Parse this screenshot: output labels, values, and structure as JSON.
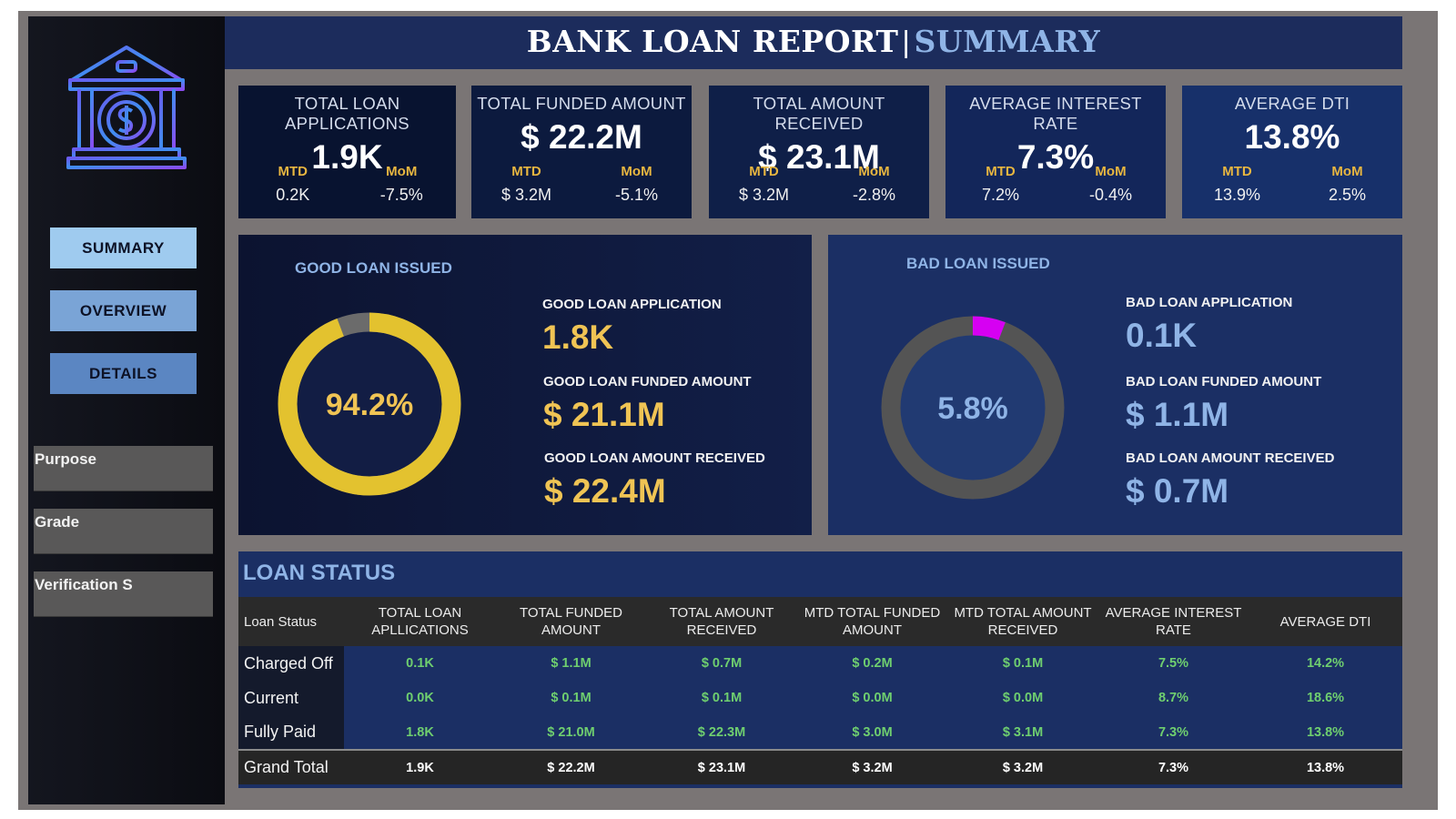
{
  "header": {
    "title_main": "BANK LOAN REPORT",
    "separator": "|",
    "title_section": "SUMMARY"
  },
  "nav": {
    "summary": "SUMMARY",
    "overview": "OVERVIEW",
    "details": "DETAILS"
  },
  "filters": {
    "purpose": "Purpose",
    "grade": "Grade",
    "verification": "Verification S"
  },
  "kpis": [
    {
      "title": "TOTAL LOAN APPLICATIONS",
      "value": "1.9K",
      "mtd_label": "MTD",
      "mtd": "0.2K",
      "mom_label": "MoM",
      "mom": "-7.5%"
    },
    {
      "title": "TOTAL FUNDED AMOUNT",
      "value": "$ 22.2M",
      "mtd_label": "MTD",
      "mtd": "$ 3.2M",
      "mom_label": "MoM",
      "mom": "-5.1%"
    },
    {
      "title": "TOTAL  AMOUNT RECEIVED",
      "value": "$ 23.1M",
      "mtd_label": "MTD",
      "mtd": "$ 3.2M",
      "mom_label": "MoM",
      "mom": "-2.8%"
    },
    {
      "title": "AVERAGE INTEREST RATE",
      "value": "7.3%",
      "mtd_label": "MTD",
      "mtd": "7.2%",
      "mom_label": "MoM",
      "mom": "-0.4%"
    },
    {
      "title": "AVERAGE DTI",
      "value": "13.8%",
      "mtd_label": "MTD",
      "mtd": "13.9%",
      "mom_label": "MoM",
      "mom": "2.5%"
    }
  ],
  "good_loan": {
    "title": "GOOD LOAN ISSUED",
    "percent_label": "94.2%",
    "percent": 94.2,
    "app_label": "GOOD LOAN APPLICATION",
    "app_value": "1.8K",
    "funded_label": "GOOD LOAN FUNDED AMOUNT",
    "funded_value": "$ 21.1M",
    "received_label": "GOOD LOAN  AMOUNT RECEIVED",
    "received_value": "$ 22.4M",
    "ring_color": "#e3c22f",
    "rest_color": "#6b6b6b"
  },
  "bad_loan": {
    "title": "BAD LOAN ISSUED",
    "percent_label": "5.8%",
    "percent": 5.8,
    "app_label": "BAD LOAN APPLICATION",
    "app_value": "0.1K",
    "funded_label": "BAD LOAN FUNDED AMOUNT",
    "funded_value": "$ 1.1M",
    "received_label": "BAD LOAN  AMOUNT RECEIVED",
    "received_value": "$ 0.7M",
    "ring_color": "#d600f2",
    "rest_color": "#545454"
  },
  "loan_status": {
    "title": "LOAN STATUS",
    "columns": [
      "Loan Status",
      "TOTAL LOAN APLLICATIONS",
      "TOTAL FUNDED AMOUNT",
      "TOTAL AMOUNT RECEIVED",
      "MTD TOTAL FUNDED AMOUNT",
      "MTD TOTAL AMOUNT RECEIVED",
      "AVERAGE INTEREST RATE",
      "AVERAGE DTI"
    ],
    "rows": [
      [
        "Charged Off",
        "0.1K",
        "$ 1.1M",
        "$ 0.7M",
        "$ 0.2M",
        "$ 0.1M",
        "7.5%",
        "14.2%"
      ],
      [
        "Current",
        "0.0K",
        "$ 0.1M",
        "$ 0.1M",
        "$ 0.0M",
        "$ 0.0M",
        "8.7%",
        "18.6%"
      ],
      [
        "Fully Paid",
        "1.8K",
        "$ 21.0M",
        "$ 22.3M",
        "$ 3.0M",
        "$ 3.1M",
        "7.3%",
        "13.8%"
      ]
    ],
    "total": [
      "Grand Total",
      "1.9K",
      "$ 22.2M",
      "$ 23.1M",
      "$ 3.2M",
      "$ 3.2M",
      "7.3%",
      "13.8%"
    ]
  },
  "icons": {
    "logo": "bank-icon"
  }
}
